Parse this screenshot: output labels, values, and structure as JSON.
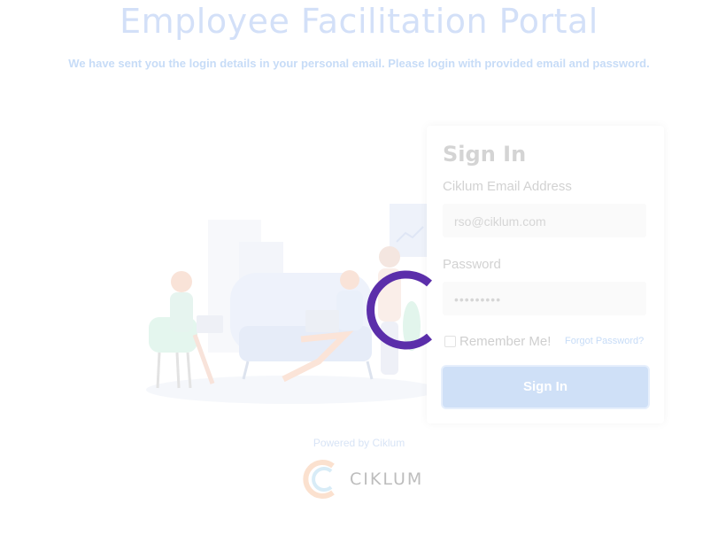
{
  "header": {
    "title": "Employee Facilitation Portal",
    "subtitle": "We have sent you the login details in your personal email. Please login with provided email and password."
  },
  "signin": {
    "title": "Sign In",
    "email_label": "Ciklum Email Address",
    "email_value": "rso@ciklum.com",
    "password_label": "Password",
    "password_value": "•••••••••",
    "remember_label": "Remember Me!",
    "forgot_label": "Forgot Password?",
    "button_label": "Sign In"
  },
  "footer": {
    "powered": "Powered by Ciklum",
    "logo_text": "CIKLUM"
  },
  "colors": {
    "accent": "#cfe0f7",
    "spinner": "#5b2eaa",
    "title": "#d3e0f8"
  },
  "icons": [
    "loading-spinner-icon",
    "ciklum-logo-icon",
    "checkbox-icon"
  ]
}
